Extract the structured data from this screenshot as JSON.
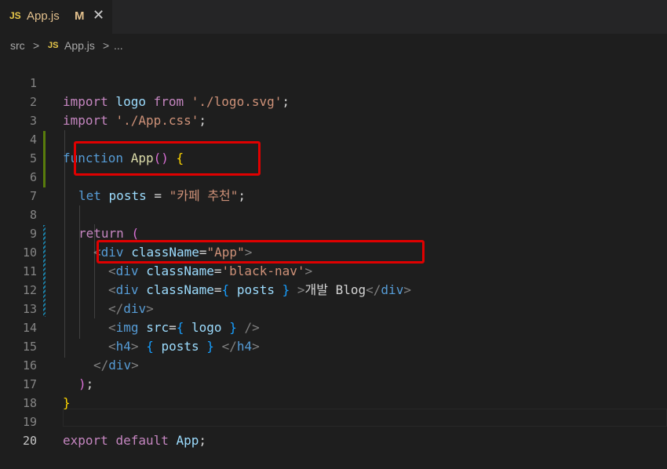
{
  "tab": {
    "icon": "JS",
    "filename": "App.js",
    "status": "M",
    "close": "✕"
  },
  "breadcrumb": {
    "folder": "src",
    "separator1": ">",
    "icon": "JS",
    "file": "App.js",
    "separator2": ">",
    "more": "..."
  },
  "code": {
    "line_numbers": [
      "1",
      "2",
      "3",
      "4",
      "5",
      "6",
      "7",
      "8",
      "9",
      "10",
      "11",
      "12",
      "13",
      "14",
      "15",
      "16",
      "17",
      "18",
      "19",
      "20"
    ],
    "l1": {
      "kw": "import",
      "a": " logo ",
      "b": "from",
      "c": " ",
      "s": "'./logo.svg'",
      "d": ";"
    },
    "l2": {
      "kw": "import",
      "a": " ",
      "s": "'./App.css'",
      "d": ";"
    },
    "l4": {
      "kw": "function",
      "a": " ",
      "fn": "App",
      "b": "()",
      "c": " ",
      "br": "{"
    },
    "l6": {
      "kw": "let",
      "a": " ",
      "v": "posts",
      "b": " = ",
      "s": "\"카페 추천\"",
      "d": ";"
    },
    "l8": {
      "kw": "return",
      "a": " ",
      "br": "("
    },
    "l9": {
      "open": "<",
      "tn": "div",
      "sp": " ",
      "at": "className",
      "eq": "=",
      "s": "\"App\"",
      "close": ">"
    },
    "l10": {
      "open": "<",
      "tn": "div",
      "sp": " ",
      "at": "className",
      "eq": "=",
      "s": "'black-nav'",
      "close": ">"
    },
    "l11": {
      "open": "<",
      "tn": "div",
      "sp": " ",
      "at": "className",
      "eq": "=",
      "br": "{",
      "sp2": " ",
      "v": "posts",
      "sp3": " ",
      "br2": "}",
      "sp4": " ",
      "close": ">",
      "text": "개발 Blog",
      "endtag": "</",
      "etn": "div",
      "eclose": ">"
    },
    "l12": {
      "endtag": "</",
      "etn": "div",
      "eclose": ">"
    },
    "l13": {
      "open": "<",
      "tn": "img",
      "sp": " ",
      "at": "src",
      "eq": "=",
      "br": "{",
      "sp2": " ",
      "v": "logo",
      "sp3": " ",
      "br2": "}",
      "sp4": " ",
      "close": "/>"
    },
    "l14": {
      "open": "<",
      "tn": "h4",
      "close": ">",
      "sp": " ",
      "br": "{",
      "sp2": " ",
      "v": "posts",
      "sp3": " ",
      "br2": "}",
      "sp4": " ",
      "endtag": "</",
      "etn": "h4",
      "eclose": ">"
    },
    "l15": {
      "endtag": "</",
      "etn": "div",
      "eclose": ">"
    },
    "l16": {
      "br": ")",
      "d": ";"
    },
    "l17": {
      "br": "}"
    },
    "l19": {
      "kw": "export",
      "a": " ",
      "kw2": "default",
      "b": " ",
      "v": "App",
      "d": ";"
    }
  },
  "colors": {
    "highlight_box": "#e00000",
    "modified_gutter": "#587c0c",
    "changed_gutter": "#1b81a8"
  }
}
